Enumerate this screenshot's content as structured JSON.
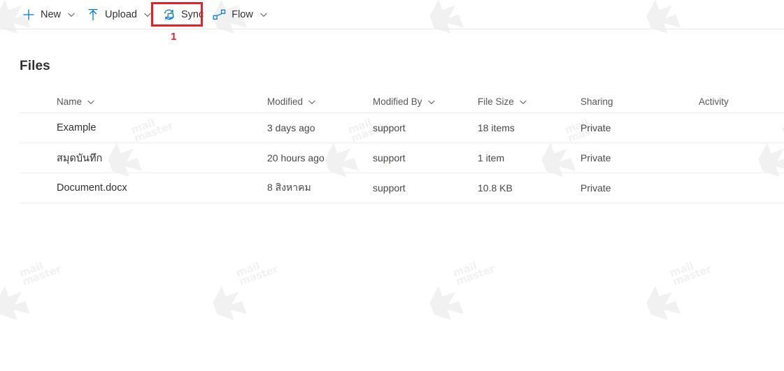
{
  "toolbar": {
    "commands": [
      {
        "id": "new",
        "label": "New",
        "icon": "plus-icon",
        "has_chevron": true
      },
      {
        "id": "upload",
        "label": "Upload",
        "icon": "upload-icon",
        "has_chevron": true
      },
      {
        "id": "sync",
        "label": "Sync",
        "icon": "sync-icon",
        "has_chevron": false
      },
      {
        "id": "flow",
        "label": "Flow",
        "icon": "flow-icon",
        "has_chevron": true
      }
    ]
  },
  "annotation": {
    "step_number": "1",
    "highlight_target": "sync",
    "highlight_color": "#ee1c25"
  },
  "page": {
    "title": "Files"
  },
  "table": {
    "columns": [
      {
        "id": "icon",
        "label": "",
        "sortable": false,
        "icon": "file-type-icon"
      },
      {
        "id": "name",
        "label": "Name",
        "sortable": true
      },
      {
        "id": "modified",
        "label": "Modified",
        "sortable": true
      },
      {
        "id": "modified_by",
        "label": "Modified By",
        "sortable": true
      },
      {
        "id": "file_size",
        "label": "File Size",
        "sortable": true
      },
      {
        "id": "sharing",
        "label": "Sharing",
        "sortable": false
      },
      {
        "id": "activity",
        "label": "Activity",
        "sortable": false
      }
    ],
    "rows": [
      {
        "icon": "folder-icon",
        "name": "Example",
        "modified": "3 days ago",
        "modified_by": "support",
        "file_size": "18 items",
        "sharing": "Private",
        "activity": "",
        "new_badge": false
      },
      {
        "icon": "folder-icon",
        "name": "สมุดบันทึก",
        "modified": "20 hours ago",
        "modified_by": "support",
        "file_size": "1 item",
        "sharing": "Private",
        "activity": "",
        "new_badge": true
      },
      {
        "icon": "word-document-icon",
        "name": "Document.docx",
        "modified": "8 สิงหาคม",
        "modified_by": "support",
        "file_size": "10.8 KB",
        "sharing": "Private",
        "activity": "",
        "new_badge": false
      }
    ]
  },
  "watermark": {
    "line1": "mail",
    "line2": "master",
    "color": "#f1f1f1"
  },
  "colors": {
    "accent": "#0078d4",
    "folder": "#fdd365",
    "word_blue": "#2b579a",
    "text_primary": "#323130",
    "text_secondary": "#605e5c",
    "divider": "#f0efee",
    "highlight_red": "#ee1c25"
  }
}
